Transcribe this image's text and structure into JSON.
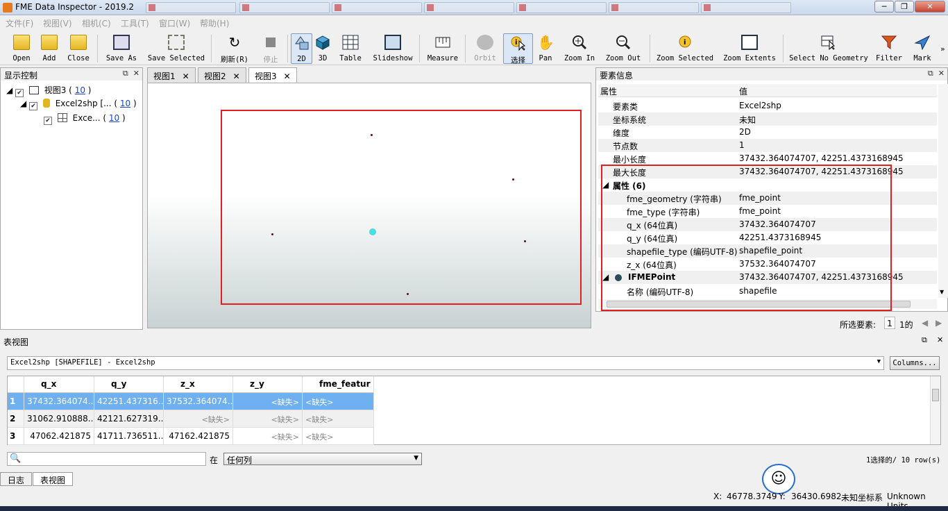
{
  "window": {
    "title": "FME Data Inspector - 2019.2"
  },
  "menu": [
    "文件(F)",
    "视图(V)",
    "相机(C)",
    "工具(T)",
    "窗口(W)",
    "帮助(H)"
  ],
  "toolbar": {
    "open": "Open",
    "add": "Add",
    "close": "Close",
    "save_as": "Save As",
    "save_selected": "Save Selected",
    "refresh": "刷新(R)",
    "stop": "停止",
    "view2d": "2D",
    "view3d": "3D",
    "table": "Table",
    "slideshow": "Slideshow",
    "measure": "Measure",
    "orbit": "Orbit",
    "select": "选择",
    "pan": "Pan",
    "zoom_in": "Zoom In",
    "zoom_out": "Zoom Out",
    "zoom_selected": "Zoom Selected",
    "zoom_extents": "Zoom Extents",
    "select_no_geometry": "Select No Geometry",
    "filter": "Filter",
    "mark": "Mark"
  },
  "display_control": {
    "title": "显示控制",
    "tree": [
      {
        "label": "视图3 (",
        "count": "10",
        "close": ")"
      },
      {
        "label": "Excel2shp [... (",
        "count": "10",
        "close": ")"
      },
      {
        "label": "Exce... (",
        "count": "10",
        "close": ")"
      }
    ]
  },
  "view_tabs": [
    "视图1",
    "视图2",
    "视图3"
  ],
  "feature_info": {
    "title": "要素信息",
    "col_attr": "属性",
    "col_value": "值",
    "rows": [
      {
        "k": "要素类",
        "v": "Excel2shp"
      },
      {
        "k": "坐标系统",
        "v": "未知"
      },
      {
        "k": "维度",
        "v": "2D"
      },
      {
        "k": "节点数",
        "v": "1"
      },
      {
        "k": "最小长度",
        "v": "37432.364074707, 42251.4373168945"
      },
      {
        "k": "最大长度",
        "v": "37432.364074707, 42251.4373168945"
      },
      {
        "k": "属性 (6)",
        "v": ""
      },
      {
        "k": "fme_geometry (字符串)",
        "v": "fme_point"
      },
      {
        "k": "fme_type (字符串)",
        "v": "fme_point"
      },
      {
        "k": "q_x (64位真)",
        "v": "37432.364074707"
      },
      {
        "k": "q_y (64位真)",
        "v": "42251.4373168945"
      },
      {
        "k": "shapefile_type (编码UTF-8)",
        "v": "shapefile_point"
      },
      {
        "k": "z_x (64位真)",
        "v": "37532.364074707"
      },
      {
        "k": "IFMEPoint",
        "v": "37432.364074707, 42251.4373168945"
      },
      {
        "k": "名称 (编码UTF-8)",
        "v": "shapefile"
      }
    ],
    "selected_label": "所选要素:",
    "selected_value": "1",
    "selected_of": "1的"
  },
  "table_view": {
    "title": "表视图",
    "layer": "Excel2shp [SHAPEFILE] - Excel2shp",
    "columns_button": "Columns...",
    "headers": [
      "q_x",
      "q_y",
      "z_x",
      "z_y",
      "fme_featur"
    ],
    "rows": [
      {
        "n": "1",
        "c": [
          "37432.364074...",
          "42251.437316...",
          "37532.364074...",
          "<缺失>",
          "<缺失>"
        ]
      },
      {
        "n": "2",
        "c": [
          "31062.910888...",
          "42121.627319...",
          "<缺失>",
          "<缺失>",
          "<缺失>"
        ]
      },
      {
        "n": "3",
        "c": [
          "47062.421875",
          "41711.736511...",
          "47162.421875",
          "<缺失>",
          "<缺失>"
        ]
      }
    ],
    "search_placeholder": "",
    "in_label": "在",
    "column_filter": "任何列",
    "selection_status": "1选择的/ 10 row(s)"
  },
  "bottom_tabs": [
    "日志",
    "表视图"
  ],
  "status": {
    "x_label": "X:",
    "x_value": "46778.3749",
    "y_label": "Y:",
    "y_value": "36430.6982",
    "crs": "未知坐标系",
    "units": "Unknown Units"
  }
}
